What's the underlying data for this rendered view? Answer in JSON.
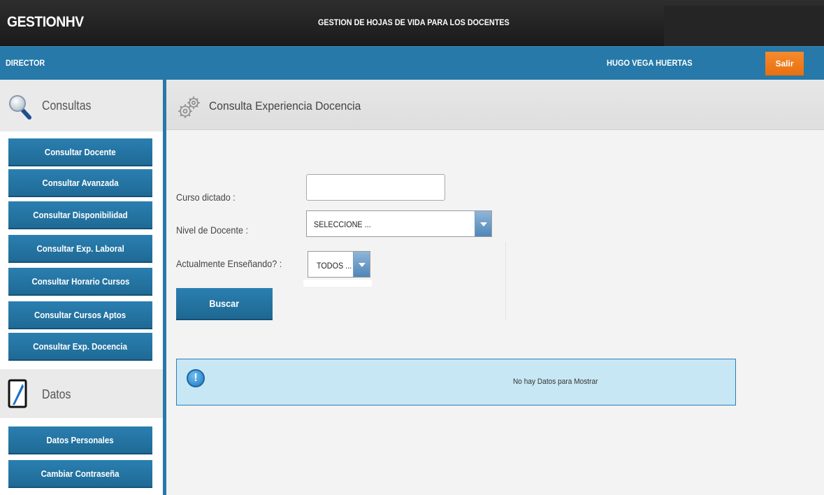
{
  "header": {
    "brand": "GESTIONHV",
    "app_title": "GESTION DE HOJAS DE VIDA PARA LOS DOCENTES"
  },
  "rolebar": {
    "role": "DIRECTOR",
    "user_name": "HUGO VEGA HUERTAS",
    "logout_label": "Salir"
  },
  "sidebar": {
    "sections": [
      {
        "title": "Consultas",
        "icon": "magnifier-icon",
        "items": [
          {
            "label": "Consultar Docente"
          },
          {
            "label": "Consultar Avanzada"
          },
          {
            "label": "Consultar Disponibilidad"
          },
          {
            "label": "Consultar Exp. Laboral"
          },
          {
            "label": "Consultar Horario Cursos"
          },
          {
            "label": "Consultar Cursos Aptos"
          },
          {
            "label": "Consultar Exp. Docencia"
          }
        ]
      },
      {
        "title": "Datos",
        "icon": "tablet-pen-icon",
        "items": [
          {
            "label": "Datos Personales"
          },
          {
            "label": "Cambiar Contraseña"
          }
        ]
      }
    ]
  },
  "main": {
    "panel_title": "Consulta Experiencia Docencia",
    "panel_icon": "gears-icon",
    "form": {
      "course_label": "Curso dictado :",
      "course_value": "",
      "level_label": "Nivel de Docente :",
      "level_selected": "SELECCIONE ...",
      "teaching_label": "Actualmente Enseñando? :",
      "teaching_selected": "TODOS ...",
      "search_label": "Buscar"
    },
    "info": {
      "icon": "info-icon",
      "message": "No hay Datos para Mostrar"
    }
  },
  "colors": {
    "topbar": "#1f1f1f",
    "primary_blue": "#2679a8",
    "logout_orange": "#f07d1d",
    "info_bg": "#c7e7f4"
  }
}
